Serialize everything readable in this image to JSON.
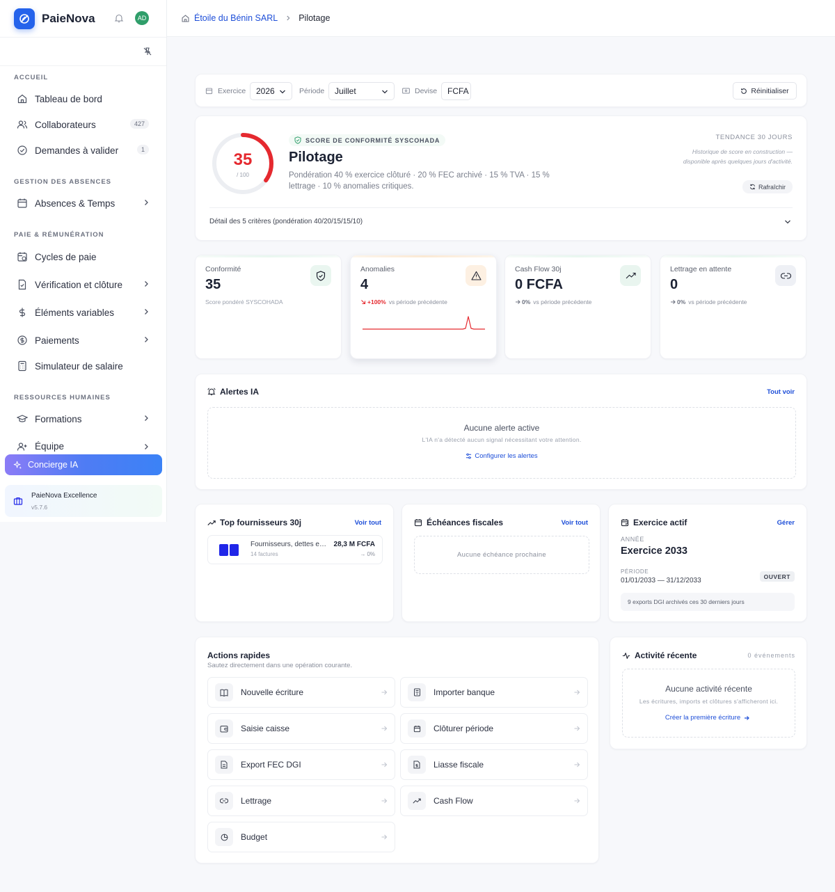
{
  "app": {
    "name": "PaieNova",
    "avatar_initials": "AD"
  },
  "breadcrumb": {
    "company": "Étoile du Bénin SARL",
    "current": "Pilotage"
  },
  "sidebar": {
    "sections": [
      {
        "label": "ACCUEIL"
      },
      {
        "label": "GESTION DES ABSENCES"
      },
      {
        "label": "PAIE & RÉMUNÉRATION"
      },
      {
        "label": "RESSOURCES HUMAINES"
      }
    ],
    "items": [
      {
        "label": "Tableau de bord",
        "icon": "home-icon"
      },
      {
        "label": "Collaborateurs",
        "icon": "users-icon",
        "badge": "427"
      },
      {
        "label": "Demandes à valider",
        "icon": "check-circle-icon",
        "badge": "1"
      },
      {
        "label": "Absences & Temps",
        "icon": "calendar-icon"
      },
      {
        "label": "Cycles de paie",
        "icon": "calendar-clock-icon"
      },
      {
        "label": "Vérification et clôture",
        "icon": "file-check-icon"
      },
      {
        "label": "Éléments variables",
        "icon": "dollar-icon"
      },
      {
        "label": "Paiements",
        "icon": "coin-icon"
      },
      {
        "label": "Simulateur de salaire",
        "icon": "calculator-icon"
      },
      {
        "label": "Formations",
        "icon": "graduation-cap-icon"
      },
      {
        "label": "Équipe",
        "icon": "user-plus-icon"
      }
    ],
    "concierge": "Concierge IA",
    "plan": {
      "name": "PaieNova Excellence",
      "version": "v5.7.6"
    }
  },
  "filters": {
    "exercice_label": "Exercice",
    "exercice_value": "2026",
    "periode_label": "Période",
    "periode_value": "Juillet",
    "devise_label": "Devise",
    "devise_value": "FCFA",
    "reset_label": "Réinitialiser"
  },
  "score": {
    "value": "35",
    "max": "/ 100",
    "fraction": 0.35,
    "tag": "SCORE DE CONFORMITÉ SYSCOHADA",
    "title": "Pilotage",
    "description": "Pondération 40 % exercice clôturé · 20 % FEC archivé · 15 % TVA · 15 % lettrage · 10 % anomalies critiques.",
    "trend_title": "TENDANCE 30 JOURS",
    "trend_desc": "Historique de score en construction — disponible après quelques jours d'activité.",
    "refresh_label": "Rafraîchir",
    "criteria_label": "Détail des 5 critères (pondération 40/20/15/15/10)",
    "colors": {
      "accent": "#e5292f",
      "track": "#eceef2"
    }
  },
  "kpis": [
    {
      "label": "Conformité",
      "value": "35",
      "sub": "Score pondéré SYSCOHADA",
      "icon": "shield-check-icon"
    },
    {
      "label": "Anomalies",
      "value": "4",
      "pct": "+100%",
      "trend_text": "vs période précédente",
      "icon": "warning-icon"
    },
    {
      "label": "Cash Flow 30j",
      "value": "0 FCFA",
      "pct": "0%",
      "trend_text": "vs période précédente",
      "icon": "trending-up-icon"
    },
    {
      "label": "Lettrage en attente",
      "value": "0",
      "pct": "0%",
      "trend_text": "vs période précédente",
      "icon": "link-icon"
    }
  ],
  "alerts": {
    "title": "Alertes IA",
    "link": "Tout voir",
    "empty_title": "Aucune alerte active",
    "empty_sub": "L'IA n'a détecté aucun signal nécessitant votre attention.",
    "configure_link": "Configurer les alertes"
  },
  "suppliers": {
    "title": "Top fournisseurs 30j",
    "link": "Voir tout",
    "rows": [
      {
        "name": "Fournisseurs, dettes en compte",
        "count": "14 factures",
        "amount": "28,3 M FCFA",
        "pct": "0%"
      }
    ]
  },
  "deadlines": {
    "title": "Échéances fiscales",
    "link": "Voir tout",
    "empty": "Aucune échéance prochaine"
  },
  "exercise": {
    "title": "Exercice actif",
    "link": "Gérer",
    "year_label": "ANNÉE",
    "name": "Exercice 2033",
    "period_label": "PÉRIODE",
    "dates": "01/01/2033 — 31/12/2033",
    "status": "OUVERT",
    "note": "9 exports DGI archivés ces 30 derniers jours"
  },
  "quick_actions": {
    "title": "Actions rapides",
    "subtitle": "Sautez directement dans une opération courante.",
    "items": [
      {
        "label": "Nouvelle écriture",
        "icon": "book-icon"
      },
      {
        "label": "Importer banque",
        "icon": "bank-icon"
      },
      {
        "label": "Saisie caisse",
        "icon": "wallet-icon"
      },
      {
        "label": "Clôturer période",
        "icon": "calendar-icon"
      },
      {
        "label": "Export FEC DGI",
        "icon": "file-text-icon"
      },
      {
        "label": "Liasse fiscale",
        "icon": "file-dollar-icon"
      },
      {
        "label": "Lettrage",
        "icon": "link-icon"
      },
      {
        "label": "Cash Flow",
        "icon": "trending-up-icon"
      },
      {
        "label": "Budget",
        "icon": "pie-chart-icon"
      }
    ]
  },
  "activity": {
    "title": "Activité récente",
    "count": "0 événements",
    "empty_title": "Aucune activité récente",
    "empty_sub": "Les écritures, imports et clôtures s'afficheront ici.",
    "link": "Créer la première écriture"
  }
}
